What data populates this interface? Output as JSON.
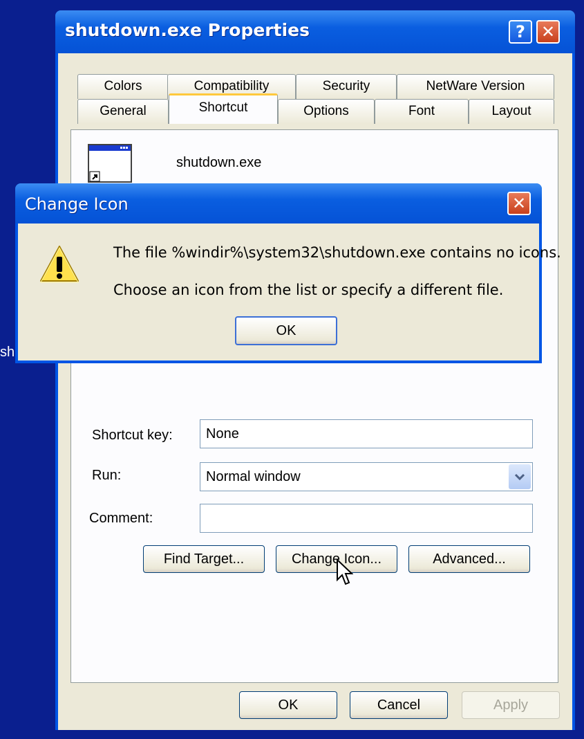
{
  "properties_window": {
    "title": "shutdown.exe Properties",
    "help_label": "?",
    "close_label": "✕",
    "tabs_row1": [
      "Colors",
      "Compatibility",
      "Security",
      "NetWare Version"
    ],
    "tabs_row2": [
      "General",
      "Shortcut",
      "Options",
      "Font",
      "Layout"
    ],
    "active_tab": "Shortcut",
    "file_name": "shutdown.exe",
    "shortcut_key_label": "Shortcut key:",
    "shortcut_key_value": "None",
    "run_label": "Run:",
    "run_value": "Normal window",
    "comment_label": "Comment:",
    "comment_value": "",
    "find_target_label": "Find Target...",
    "change_icon_label": "Change Icon...",
    "advanced_label": "Advanced...",
    "ok_label": "OK",
    "cancel_label": "Cancel",
    "apply_label": "Apply"
  },
  "change_icon_dialog": {
    "title": "Change Icon",
    "close_label": "✕",
    "message_line1": "The file %windir%\\system32\\shutdown.exe contains no icons.",
    "message_line2": "Choose an icon from the list or specify a different file.",
    "ok_label": "OK",
    "warning_icon": "warning-icon"
  },
  "background_text": "sh"
}
